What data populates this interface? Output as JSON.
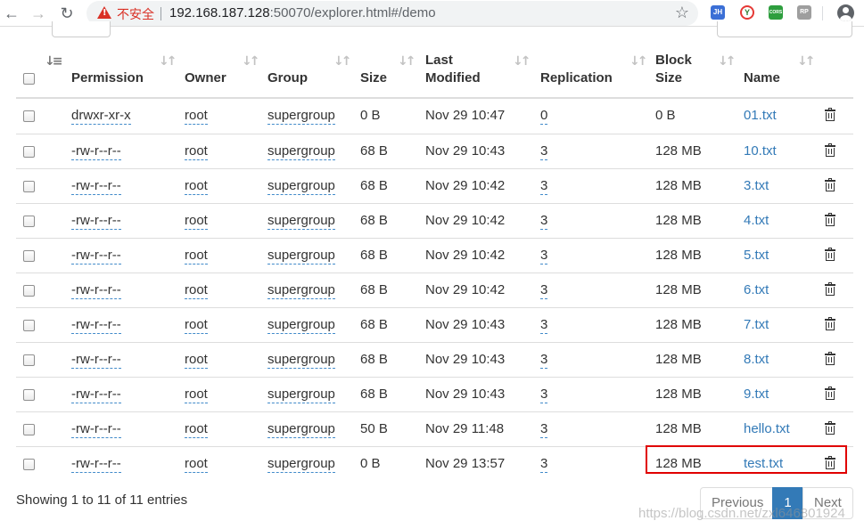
{
  "browser": {
    "insecure_label": "不安全",
    "url_host": "192.168.187.128",
    "url_rest": ":50070/explorer.html#/demo",
    "extensions": [
      "JH",
      "Y",
      "CORS",
      "RP"
    ]
  },
  "table": {
    "columns": [
      {
        "label": "Permission"
      },
      {
        "label": "Owner"
      },
      {
        "label": "Group"
      },
      {
        "label": "Size"
      },
      {
        "label_line1": "Last",
        "label_line2": "Modified"
      },
      {
        "label": "Replication"
      },
      {
        "label_line1": "Block",
        "label_line2": "Size"
      },
      {
        "label": "Name"
      }
    ],
    "rows": [
      {
        "permission": "drwxr-xr-x",
        "owner": "root",
        "group": "supergroup",
        "size": "0 B",
        "modified": "Nov 29 10:47",
        "replication": "0",
        "block_size": "0 B",
        "name": "01.txt"
      },
      {
        "permission": "-rw-r--r--",
        "owner": "root",
        "group": "supergroup",
        "size": "68 B",
        "modified": "Nov 29 10:43",
        "replication": "3",
        "block_size": "128 MB",
        "name": "10.txt"
      },
      {
        "permission": "-rw-r--r--",
        "owner": "root",
        "group": "supergroup",
        "size": "68 B",
        "modified": "Nov 29 10:42",
        "replication": "3",
        "block_size": "128 MB",
        "name": "3.txt"
      },
      {
        "permission": "-rw-r--r--",
        "owner": "root",
        "group": "supergroup",
        "size": "68 B",
        "modified": "Nov 29 10:42",
        "replication": "3",
        "block_size": "128 MB",
        "name": "4.txt"
      },
      {
        "permission": "-rw-r--r--",
        "owner": "root",
        "group": "supergroup",
        "size": "68 B",
        "modified": "Nov 29 10:42",
        "replication": "3",
        "block_size": "128 MB",
        "name": "5.txt"
      },
      {
        "permission": "-rw-r--r--",
        "owner": "root",
        "group": "supergroup",
        "size": "68 B",
        "modified": "Nov 29 10:42",
        "replication": "3",
        "block_size": "128 MB",
        "name": "6.txt"
      },
      {
        "permission": "-rw-r--r--",
        "owner": "root",
        "group": "supergroup",
        "size": "68 B",
        "modified": "Nov 29 10:43",
        "replication": "3",
        "block_size": "128 MB",
        "name": "7.txt"
      },
      {
        "permission": "-rw-r--r--",
        "owner": "root",
        "group": "supergroup",
        "size": "68 B",
        "modified": "Nov 29 10:43",
        "replication": "3",
        "block_size": "128 MB",
        "name": "8.txt"
      },
      {
        "permission": "-rw-r--r--",
        "owner": "root",
        "group": "supergroup",
        "size": "68 B",
        "modified": "Nov 29 10:43",
        "replication": "3",
        "block_size": "128 MB",
        "name": "9.txt"
      },
      {
        "permission": "-rw-r--r--",
        "owner": "root",
        "group": "supergroup",
        "size": "50 B",
        "modified": "Nov 29 11:48",
        "replication": "3",
        "block_size": "128 MB",
        "name": "hello.txt"
      },
      {
        "permission": "-rw-r--r--",
        "owner": "root",
        "group": "supergroup",
        "size": "0 B",
        "modified": "Nov 29 13:57",
        "replication": "3",
        "block_size": "128 MB",
        "name": "test.txt"
      }
    ]
  },
  "footer": {
    "info": "Showing 1 to 11 of 11 entries",
    "previous": "Previous",
    "current_page": "1",
    "next": "Next"
  },
  "watermark": "https://blog.csdn.net/zxl646801924",
  "colors": {
    "link": "#337ab7",
    "highlight": "#e00000",
    "insecure": "#d93025"
  }
}
